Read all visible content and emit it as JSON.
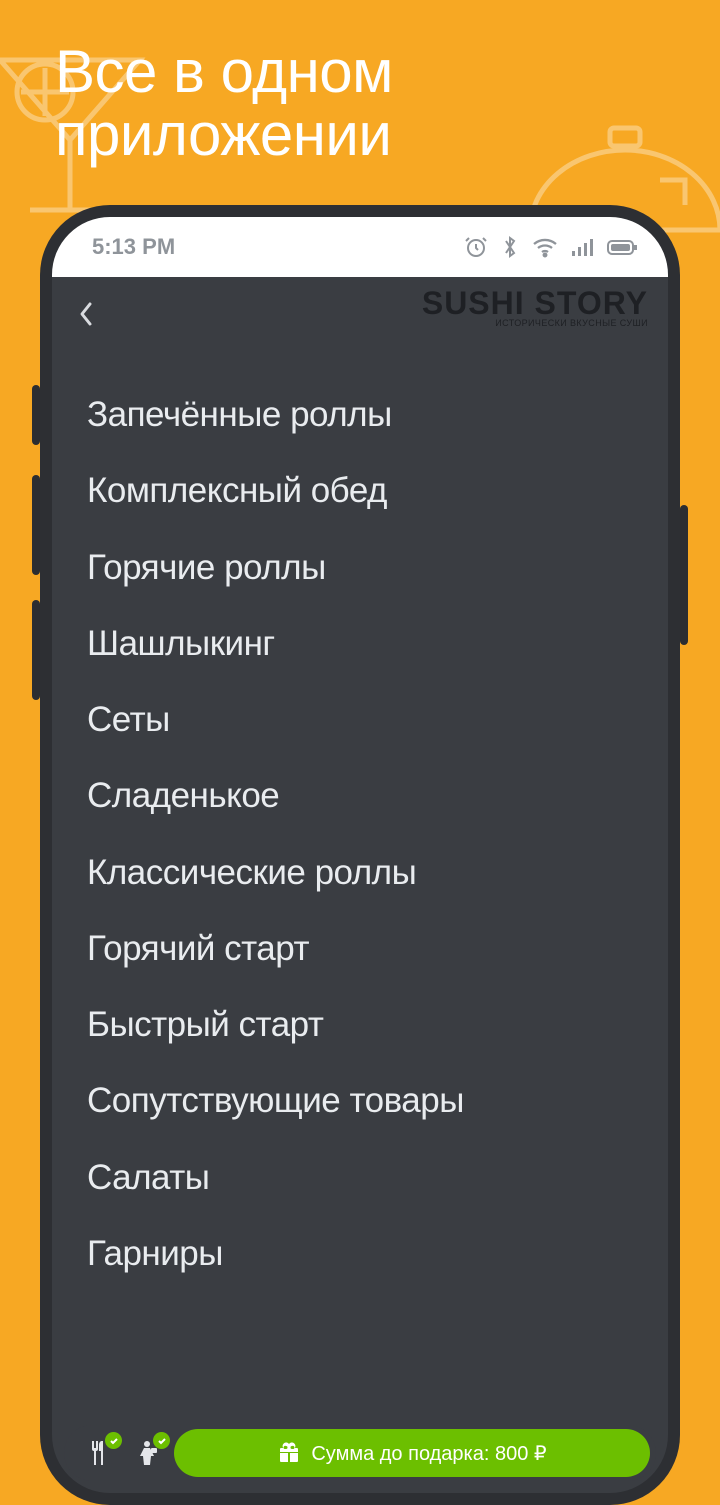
{
  "promo": {
    "headline": "Все в одном приложении"
  },
  "status": {
    "time": "5:13 PM"
  },
  "header": {
    "brand": "SUSHI STORY",
    "tagline": "ИСТОРИЧЕСКИ ВКУСНЫЕ СУШИ"
  },
  "menu": {
    "items": [
      "Запечённые роллы",
      "Комплексный обед",
      "Горячие роллы",
      "Шашлыкинг",
      "Сеты",
      "Сладенькое",
      "Классические роллы",
      "Горячий старт",
      "Быстрый старт",
      "Сопутствующие товары",
      "Салаты",
      "Гарниры"
    ]
  },
  "bottom": {
    "gift_label": "Сумма до подарка: 800 ₽"
  }
}
